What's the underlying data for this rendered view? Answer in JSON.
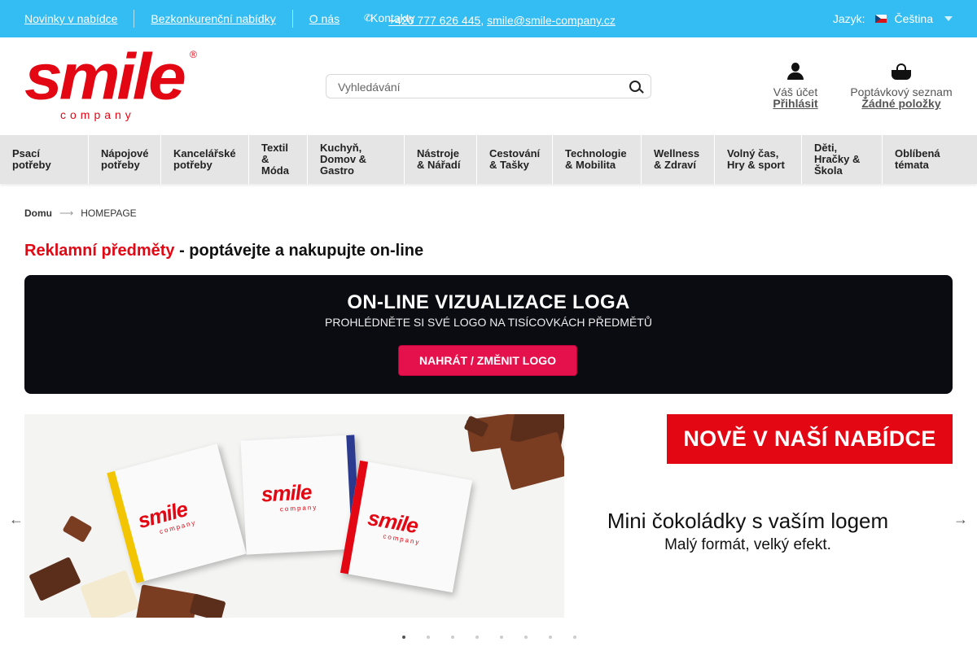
{
  "topbar": {
    "links": [
      "Novinky v nabídce",
      "Bezkonkurenční nabídky",
      "O nás"
    ],
    "contacts_label": "Kontakty",
    "phone": "+420 777 626 445",
    "separator": ",",
    "email": "smile@smile-company.cz",
    "language_label": "Jazyk:",
    "language_value": "Čeština"
  },
  "header": {
    "logo_word": "smile",
    "logo_sub": "company",
    "logo_reg": "®",
    "search_placeholder": "Vyhledávání",
    "account_title": "Váš účet",
    "account_link": "Přihlásit",
    "cart_title": "Poptávkový seznam",
    "cart_link": "Žádné položky"
  },
  "categories": [
    "Psací\npotřeby",
    "Nápojové\npotřeby",
    "Kancelářské\npotřeby",
    "Textil\n&\nMóda",
    "Kuchyň,\nDomov &\nGastro",
    "Nástroje\n& Nářadí",
    "Cestování\n& Tašky",
    "Technologie\n& Mobilita",
    "Wellness\n& Zdraví",
    "Volný čas,\nHry & sport",
    "Děti,\nHračky &\nŠkola",
    "Oblíbená\ntémata"
  ],
  "breadcrumb": {
    "home": "Domu",
    "current": "HOMEPAGE"
  },
  "headline": {
    "red": "Reklamní předměty",
    "rest": " - poptávejte a nakupujte on-line"
  },
  "viz": {
    "title": "ON-LINE VIZUALIZACE LOGA",
    "subtitle": "PROHLÉDNĚTE SI SVÉ LOGO NA TISÍCOVKÁCH PŘEDMĚTŮ",
    "button": "NAHRÁT / ZMĚNIT LOGO"
  },
  "slide": {
    "band": "NOVĚ V NAŠÍ NABÍDCE",
    "title": "Mini čokoládky s vaším logem",
    "subtitle": "Malý formát, velký efekt.",
    "wrapper_logo": "smile",
    "wrapper_sub": "company",
    "band_colors": [
      "#f2c500",
      "#2b3a8f",
      "#e30613"
    ],
    "prev": "←",
    "next": "→",
    "dot_count": 8,
    "active_dot": 0
  },
  "colors": {
    "topbar": "#33bdf2",
    "brand_red": "#e30613",
    "cta": "#e5114d",
    "viz_bg": "#0b0b12"
  }
}
